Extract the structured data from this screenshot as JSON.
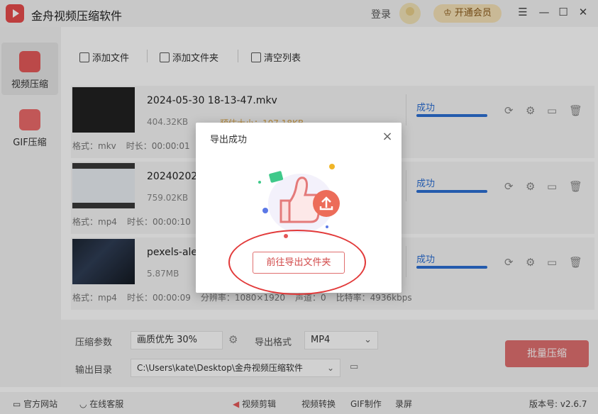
{
  "app": {
    "title": "金舟视频压缩软件",
    "login": "登录",
    "vip_button": "开通会员"
  },
  "window_controls": {
    "menu": "☰",
    "minimize": "—",
    "maximize": "☐",
    "close": "✕"
  },
  "sidebar": {
    "items": [
      {
        "label": "视频压缩",
        "icon": "video-compress-icon"
      },
      {
        "label": "GIF压缩",
        "icon": "gif-icon"
      }
    ]
  },
  "toolbar": {
    "add_file": "添加文件",
    "add_folder": "添加文件夹",
    "clear_list": "清空列表"
  },
  "files": [
    {
      "name": "2024-05-30 18-13-47.mkv",
      "size": "404.32KB",
      "estimated": "预估大小：107.18KB",
      "format_label": "格式：mkv",
      "duration_label": "时长：00:00:01",
      "status": "成功",
      "progress": 1.0
    },
    {
      "name": "20240202",
      "size": "759.02KB",
      "format_label": "格式：mp4",
      "duration_label": "时长：00:00:10",
      "status": "成功",
      "progress": 1.0
    },
    {
      "name": "pexels-ale",
      "size": "5.87MB",
      "format_label": "格式：mp4",
      "duration_label": "时长：00:00:09",
      "resolution_label": "分辨率：1080×1920",
      "audio_label": "声道：0",
      "bitrate_label": "比特率：4936kbps",
      "status": "成功",
      "progress": 1.0
    }
  ],
  "settings": {
    "param_label": "压缩参数",
    "quality_value": "画质优先 30%",
    "format_label": "导出格式",
    "format_value": "MP4",
    "output_label": "输出目录",
    "output_path": "C:\\Users\\kate\\Desktop\\金舟视频压缩软件",
    "batch_button": "批量压缩"
  },
  "statusbar": {
    "website": "官方网站",
    "support": "在线客服",
    "edit": "视频剪辑",
    "convert": "视频转换",
    "gif": "GIF制作",
    "record": "录屏",
    "version": "版本号: v2.6.7"
  },
  "dialog": {
    "title": "导出成功",
    "open_folder_button": "前往导出文件夹",
    "close": "×"
  },
  "colors": {
    "accent": "#e06f6f",
    "success_blue": "#2d6fd4",
    "highlight_red": "#e23a3a"
  }
}
